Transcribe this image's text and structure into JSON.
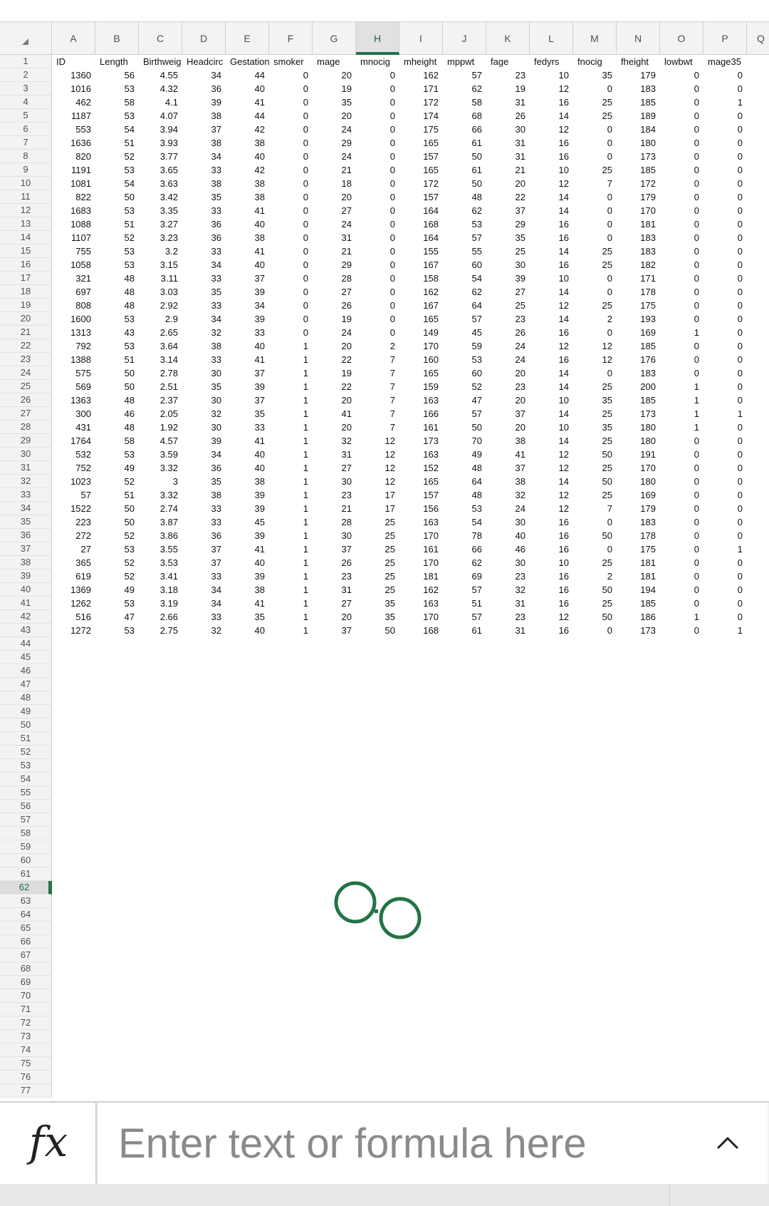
{
  "sheet": {
    "columns": [
      "A",
      "B",
      "C",
      "D",
      "E",
      "F",
      "G",
      "H",
      "I",
      "J",
      "K",
      "L",
      "M",
      "N",
      "O",
      "P",
      "Q"
    ],
    "selected_column": "H",
    "selected_row": 62,
    "row_count": 77,
    "headers": [
      "ID",
      "Length",
      "Birthweig",
      "Headcirc",
      "Gestation",
      "smoker",
      "mage",
      "mnocig",
      "mheight",
      "mppwt",
      "fage",
      "fedyrs",
      "fnocig",
      "fheight",
      "lowbwt",
      "mage35"
    ],
    "rows": [
      [
        "1360",
        "56",
        "4.55",
        "34",
        "44",
        "0",
        "20",
        "0",
        "162",
        "57",
        "23",
        "10",
        "35",
        "179",
        "0",
        "0"
      ],
      [
        "1016",
        "53",
        "4.32",
        "36",
        "40",
        "0",
        "19",
        "0",
        "171",
        "62",
        "19",
        "12",
        "0",
        "183",
        "0",
        "0"
      ],
      [
        "462",
        "58",
        "4.1",
        "39",
        "41",
        "0",
        "35",
        "0",
        "172",
        "58",
        "31",
        "16",
        "25",
        "185",
        "0",
        "1"
      ],
      [
        "1187",
        "53",
        "4.07",
        "38",
        "44",
        "0",
        "20",
        "0",
        "174",
        "68",
        "26",
        "14",
        "25",
        "189",
        "0",
        "0"
      ],
      [
        "553",
        "54",
        "3.94",
        "37",
        "42",
        "0",
        "24",
        "0",
        "175",
        "66",
        "30",
        "12",
        "0",
        "184",
        "0",
        "0"
      ],
      [
        "1636",
        "51",
        "3.93",
        "38",
        "38",
        "0",
        "29",
        "0",
        "165",
        "61",
        "31",
        "16",
        "0",
        "180",
        "0",
        "0"
      ],
      [
        "820",
        "52",
        "3.77",
        "34",
        "40",
        "0",
        "24",
        "0",
        "157",
        "50",
        "31",
        "16",
        "0",
        "173",
        "0",
        "0"
      ],
      [
        "1191",
        "53",
        "3.65",
        "33",
        "42",
        "0",
        "21",
        "0",
        "165",
        "61",
        "21",
        "10",
        "25",
        "185",
        "0",
        "0"
      ],
      [
        "1081",
        "54",
        "3.63",
        "38",
        "38",
        "0",
        "18",
        "0",
        "172",
        "50",
        "20",
        "12",
        "7",
        "172",
        "0",
        "0"
      ],
      [
        "822",
        "50",
        "3.42",
        "35",
        "38",
        "0",
        "20",
        "0",
        "157",
        "48",
        "22",
        "14",
        "0",
        "179",
        "0",
        "0"
      ],
      [
        "1683",
        "53",
        "3.35",
        "33",
        "41",
        "0",
        "27",
        "0",
        "164",
        "62",
        "37",
        "14",
        "0",
        "170",
        "0",
        "0"
      ],
      [
        "1088",
        "51",
        "3.27",
        "36",
        "40",
        "0",
        "24",
        "0",
        "168",
        "53",
        "29",
        "16",
        "0",
        "181",
        "0",
        "0"
      ],
      [
        "1107",
        "52",
        "3.23",
        "36",
        "38",
        "0",
        "31",
        "0",
        "164",
        "57",
        "35",
        "16",
        "0",
        "183",
        "0",
        "0"
      ],
      [
        "755",
        "53",
        "3.2",
        "33",
        "41",
        "0",
        "21",
        "0",
        "155",
        "55",
        "25",
        "14",
        "25",
        "183",
        "0",
        "0"
      ],
      [
        "1058",
        "53",
        "3.15",
        "34",
        "40",
        "0",
        "29",
        "0",
        "167",
        "60",
        "30",
        "16",
        "25",
        "182",
        "0",
        "0"
      ],
      [
        "321",
        "48",
        "3.11",
        "33",
        "37",
        "0",
        "28",
        "0",
        "158",
        "54",
        "39",
        "10",
        "0",
        "171",
        "0",
        "0"
      ],
      [
        "697",
        "48",
        "3.03",
        "35",
        "39",
        "0",
        "27",
        "0",
        "162",
        "62",
        "27",
        "14",
        "0",
        "178",
        "0",
        "0"
      ],
      [
        "808",
        "48",
        "2.92",
        "33",
        "34",
        "0",
        "26",
        "0",
        "167",
        "64",
        "25",
        "12",
        "25",
        "175",
        "0",
        "0"
      ],
      [
        "1600",
        "53",
        "2.9",
        "34",
        "39",
        "0",
        "19",
        "0",
        "165",
        "57",
        "23",
        "14",
        "2",
        "193",
        "0",
        "0"
      ],
      [
        "1313",
        "43",
        "2.65",
        "32",
        "33",
        "0",
        "24",
        "0",
        "149",
        "45",
        "26",
        "16",
        "0",
        "169",
        "1",
        "0"
      ],
      [
        "792",
        "53",
        "3.64",
        "38",
        "40",
        "1",
        "20",
        "2",
        "170",
        "59",
        "24",
        "12",
        "12",
        "185",
        "0",
        "0"
      ],
      [
        "1388",
        "51",
        "3.14",
        "33",
        "41",
        "1",
        "22",
        "7",
        "160",
        "53",
        "24",
        "16",
        "12",
        "176",
        "0",
        "0"
      ],
      [
        "575",
        "50",
        "2.78",
        "30",
        "37",
        "1",
        "19",
        "7",
        "165",
        "60",
        "20",
        "14",
        "0",
        "183",
        "0",
        "0"
      ],
      [
        "569",
        "50",
        "2.51",
        "35",
        "39",
        "1",
        "22",
        "7",
        "159",
        "52",
        "23",
        "14",
        "25",
        "200",
        "1",
        "0"
      ],
      [
        "1363",
        "48",
        "2.37",
        "30",
        "37",
        "1",
        "20",
        "7",
        "163",
        "47",
        "20",
        "10",
        "35",
        "185",
        "1",
        "0"
      ],
      [
        "300",
        "46",
        "2.05",
        "32",
        "35",
        "1",
        "41",
        "7",
        "166",
        "57",
        "37",
        "14",
        "25",
        "173",
        "1",
        "1"
      ],
      [
        "431",
        "48",
        "1.92",
        "30",
        "33",
        "1",
        "20",
        "7",
        "161",
        "50",
        "20",
        "10",
        "35",
        "180",
        "1",
        "0"
      ],
      [
        "1764",
        "58",
        "4.57",
        "39",
        "41",
        "1",
        "32",
        "12",
        "173",
        "70",
        "38",
        "14",
        "25",
        "180",
        "0",
        "0"
      ],
      [
        "532",
        "53",
        "3.59",
        "34",
        "40",
        "1",
        "31",
        "12",
        "163",
        "49",
        "41",
        "12",
        "50",
        "191",
        "0",
        "0"
      ],
      [
        "752",
        "49",
        "3.32",
        "36",
        "40",
        "1",
        "27",
        "12",
        "152",
        "48",
        "37",
        "12",
        "25",
        "170",
        "0",
        "0"
      ],
      [
        "1023",
        "52",
        "3",
        "35",
        "38",
        "1",
        "30",
        "12",
        "165",
        "64",
        "38",
        "14",
        "50",
        "180",
        "0",
        "0"
      ],
      [
        "57",
        "51",
        "3.32",
        "38",
        "39",
        "1",
        "23",
        "17",
        "157",
        "48",
        "32",
        "12",
        "25",
        "169",
        "0",
        "0"
      ],
      [
        "1522",
        "50",
        "2.74",
        "33",
        "39",
        "1",
        "21",
        "17",
        "156",
        "53",
        "24",
        "12",
        "7",
        "179",
        "0",
        "0"
      ],
      [
        "223",
        "50",
        "3.87",
        "33",
        "45",
        "1",
        "28",
        "25",
        "163",
        "54",
        "30",
        "16",
        "0",
        "183",
        "0",
        "0"
      ],
      [
        "272",
        "52",
        "3.86",
        "36",
        "39",
        "1",
        "30",
        "25",
        "170",
        "78",
        "40",
        "16",
        "50",
        "178",
        "0",
        "0"
      ],
      [
        "27",
        "53",
        "3.55",
        "37",
        "41",
        "1",
        "37",
        "25",
        "161",
        "66",
        "46",
        "16",
        "0",
        "175",
        "0",
        "1"
      ],
      [
        "365",
        "52",
        "3.53",
        "37",
        "40",
        "1",
        "26",
        "25",
        "170",
        "62",
        "30",
        "10",
        "25",
        "181",
        "0",
        "0"
      ],
      [
        "619",
        "52",
        "3.41",
        "33",
        "39",
        "1",
        "23",
        "25",
        "181",
        "69",
        "23",
        "16",
        "2",
        "181",
        "0",
        "0"
      ],
      [
        "1369",
        "49",
        "3.18",
        "34",
        "38",
        "1",
        "31",
        "25",
        "162",
        "57",
        "32",
        "16",
        "50",
        "194",
        "0",
        "0"
      ],
      [
        "1262",
        "53",
        "3.19",
        "34",
        "41",
        "1",
        "27",
        "35",
        "163",
        "51",
        "31",
        "16",
        "25",
        "185",
        "0",
        "0"
      ],
      [
        "516",
        "47",
        "2.66",
        "33",
        "35",
        "1",
        "20",
        "35",
        "170",
        "57",
        "23",
        "12",
        "50",
        "186",
        "1",
        "0"
      ],
      [
        "1272",
        "53",
        "2.75",
        "32",
        "40",
        "1",
        "37",
        "50",
        "168",
        "61",
        "31",
        "16",
        "0",
        "173",
        "0",
        "1"
      ]
    ]
  },
  "loading_indicator": {
    "icon": "loading-circles-icon",
    "color": "#217346"
  },
  "formula_bar": {
    "fx_label": "fx",
    "placeholder": "Enter text or formula here",
    "value": "",
    "expand_icon": "chevron-up-icon"
  },
  "colors": {
    "accent": "#217346",
    "header_bg": "#f3f3f3",
    "grid_text": "#111111"
  }
}
